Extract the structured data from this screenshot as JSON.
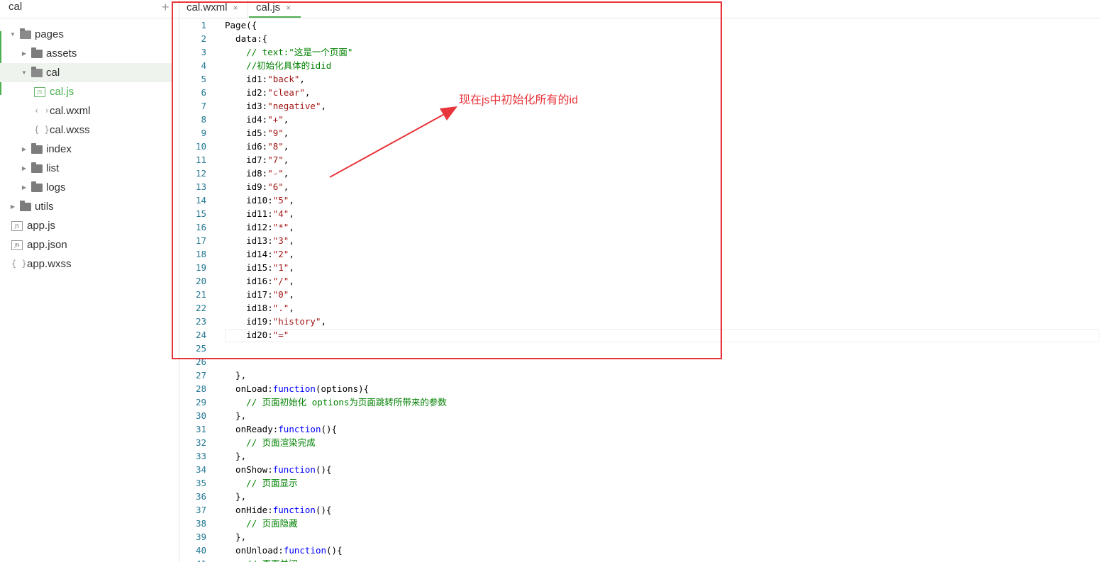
{
  "sidebar": {
    "project_title": "cal",
    "add_symbol": "+",
    "tree": [
      {
        "label": "pages",
        "type": "folder",
        "open": true
      },
      {
        "label": "assets",
        "type": "folder",
        "open": false
      },
      {
        "label": "cal",
        "type": "folder",
        "open": true
      },
      {
        "label": "cal.js",
        "type": "js"
      },
      {
        "label": "cal.wxml",
        "type": "wxml"
      },
      {
        "label": "cal.wxss",
        "type": "wxss"
      },
      {
        "label": "index",
        "type": "folder",
        "open": false
      },
      {
        "label": "list",
        "type": "folder",
        "open": false
      },
      {
        "label": "logs",
        "type": "folder",
        "open": false
      },
      {
        "label": "utils",
        "type": "folder",
        "open": false
      },
      {
        "label": "app.js",
        "type": "js"
      },
      {
        "label": "app.json",
        "type": "json"
      },
      {
        "label": "app.wxss",
        "type": "wxss"
      }
    ],
    "badges": {
      "js": "JS",
      "json": "JN",
      "wxml": "‹ ›",
      "wxss": "{ }"
    }
  },
  "tabs": [
    {
      "label": "cal.wxml",
      "close": "×",
      "active": false
    },
    {
      "label": "cal.js",
      "close": "×",
      "active": true
    }
  ],
  "annotation": {
    "text": "现在js中初始化所有的id",
    "color": "#e8353b"
  },
  "editor": {
    "lines": [
      {
        "n": "1",
        "tokens": [
          [
            "p",
            "Page({"
          ]
        ]
      },
      {
        "n": "2",
        "tokens": [
          [
            "p",
            "  data:{"
          ]
        ]
      },
      {
        "n": "3",
        "tokens": [
          [
            "c",
            "    // text:\"这是一个页面\""
          ]
        ]
      },
      {
        "n": "4",
        "tokens": [
          [
            "c",
            "    //初始化具体的idid"
          ]
        ]
      },
      {
        "n": "5",
        "tokens": [
          [
            "p",
            "    id1:"
          ],
          [
            "s",
            "\"back\""
          ],
          [
            "p",
            ","
          ]
        ]
      },
      {
        "n": "6",
        "tokens": [
          [
            "p",
            "    id2:"
          ],
          [
            "s",
            "\"clear\""
          ],
          [
            "p",
            ","
          ]
        ]
      },
      {
        "n": "7",
        "tokens": [
          [
            "p",
            "    id3:"
          ],
          [
            "s",
            "\"negative\""
          ],
          [
            "p",
            ","
          ]
        ]
      },
      {
        "n": "8",
        "tokens": [
          [
            "p",
            "    id4:"
          ],
          [
            "s",
            "\"+\""
          ],
          [
            "p",
            ","
          ]
        ]
      },
      {
        "n": "9",
        "tokens": [
          [
            "p",
            "    id5:"
          ],
          [
            "s",
            "\"9\""
          ],
          [
            "p",
            ","
          ]
        ]
      },
      {
        "n": "10",
        "tokens": [
          [
            "p",
            "    id6:"
          ],
          [
            "s",
            "\"8\""
          ],
          [
            "p",
            ","
          ]
        ]
      },
      {
        "n": "11",
        "tokens": [
          [
            "p",
            "    id7:"
          ],
          [
            "s",
            "\"7\""
          ],
          [
            "p",
            ","
          ]
        ]
      },
      {
        "n": "12",
        "tokens": [
          [
            "p",
            "    id8:"
          ],
          [
            "s",
            "\"-\""
          ],
          [
            "p",
            ","
          ]
        ]
      },
      {
        "n": "13",
        "tokens": [
          [
            "p",
            "    id9:"
          ],
          [
            "s",
            "\"6\""
          ],
          [
            "p",
            ","
          ]
        ]
      },
      {
        "n": "14",
        "tokens": [
          [
            "p",
            "    id10:"
          ],
          [
            "s",
            "\"5\""
          ],
          [
            "p",
            ","
          ]
        ]
      },
      {
        "n": "15",
        "tokens": [
          [
            "p",
            "    id11:"
          ],
          [
            "s",
            "\"4\""
          ],
          [
            "p",
            ","
          ]
        ]
      },
      {
        "n": "16",
        "tokens": [
          [
            "p",
            "    id12:"
          ],
          [
            "s",
            "\"*\""
          ],
          [
            "p",
            ","
          ]
        ]
      },
      {
        "n": "17",
        "tokens": [
          [
            "p",
            "    id13:"
          ],
          [
            "s",
            "\"3\""
          ],
          [
            "p",
            ","
          ]
        ]
      },
      {
        "n": "18",
        "tokens": [
          [
            "p",
            "    id14:"
          ],
          [
            "s",
            "\"2\""
          ],
          [
            "p",
            ","
          ]
        ]
      },
      {
        "n": "19",
        "tokens": [
          [
            "p",
            "    id15:"
          ],
          [
            "s",
            "\"1\""
          ],
          [
            "p",
            ","
          ]
        ]
      },
      {
        "n": "20",
        "tokens": [
          [
            "p",
            "    id16:"
          ],
          [
            "s",
            "\"/\""
          ],
          [
            "p",
            ","
          ]
        ]
      },
      {
        "n": "21",
        "tokens": [
          [
            "p",
            "    id17:"
          ],
          [
            "s",
            "\"0\""
          ],
          [
            "p",
            ","
          ]
        ]
      },
      {
        "n": "22",
        "tokens": [
          [
            "p",
            "    id18:"
          ],
          [
            "s",
            "\".\""
          ],
          [
            "p",
            ","
          ]
        ]
      },
      {
        "n": "23",
        "tokens": [
          [
            "p",
            "    id19:"
          ],
          [
            "s",
            "\"history\""
          ],
          [
            "p",
            ","
          ]
        ]
      },
      {
        "n": "24",
        "tokens": [
          [
            "p",
            "    id20:"
          ],
          [
            "s",
            "\"=\""
          ]
        ]
      },
      {
        "n": "25",
        "tokens": []
      },
      {
        "n": "26",
        "tokens": []
      },
      {
        "n": "27",
        "tokens": [
          [
            "p",
            "  },"
          ]
        ]
      },
      {
        "n": "28",
        "tokens": [
          [
            "p",
            "  onLoad:"
          ],
          [
            "k",
            "function"
          ],
          [
            "p",
            "(options){"
          ]
        ]
      },
      {
        "n": "29",
        "tokens": [
          [
            "c",
            "    // 页面初始化 options为页面跳转所带来的参数"
          ]
        ]
      },
      {
        "n": "30",
        "tokens": [
          [
            "p",
            "  },"
          ]
        ]
      },
      {
        "n": "31",
        "tokens": [
          [
            "p",
            "  onReady:"
          ],
          [
            "k",
            "function"
          ],
          [
            "p",
            "(){"
          ]
        ]
      },
      {
        "n": "32",
        "tokens": [
          [
            "c",
            "    // 页面渲染完成"
          ]
        ]
      },
      {
        "n": "33",
        "tokens": [
          [
            "p",
            "  },"
          ]
        ]
      },
      {
        "n": "34",
        "tokens": [
          [
            "p",
            "  onShow:"
          ],
          [
            "k",
            "function"
          ],
          [
            "p",
            "(){"
          ]
        ]
      },
      {
        "n": "35",
        "tokens": [
          [
            "c",
            "    // 页面显示"
          ]
        ]
      },
      {
        "n": "36",
        "tokens": [
          [
            "p",
            "  },"
          ]
        ]
      },
      {
        "n": "37",
        "tokens": [
          [
            "p",
            "  onHide:"
          ],
          [
            "k",
            "function"
          ],
          [
            "p",
            "(){"
          ]
        ]
      },
      {
        "n": "38",
        "tokens": [
          [
            "c",
            "    // 页面隐藏"
          ]
        ]
      },
      {
        "n": "39",
        "tokens": [
          [
            "p",
            "  },"
          ]
        ]
      },
      {
        "n": "40",
        "tokens": [
          [
            "p",
            "  onUnload:"
          ],
          [
            "k",
            "function"
          ],
          [
            "p",
            "(){"
          ]
        ]
      },
      {
        "n": "41",
        "tokens": [
          [
            "c",
            "    // 页面关闭"
          ]
        ]
      }
    ]
  }
}
